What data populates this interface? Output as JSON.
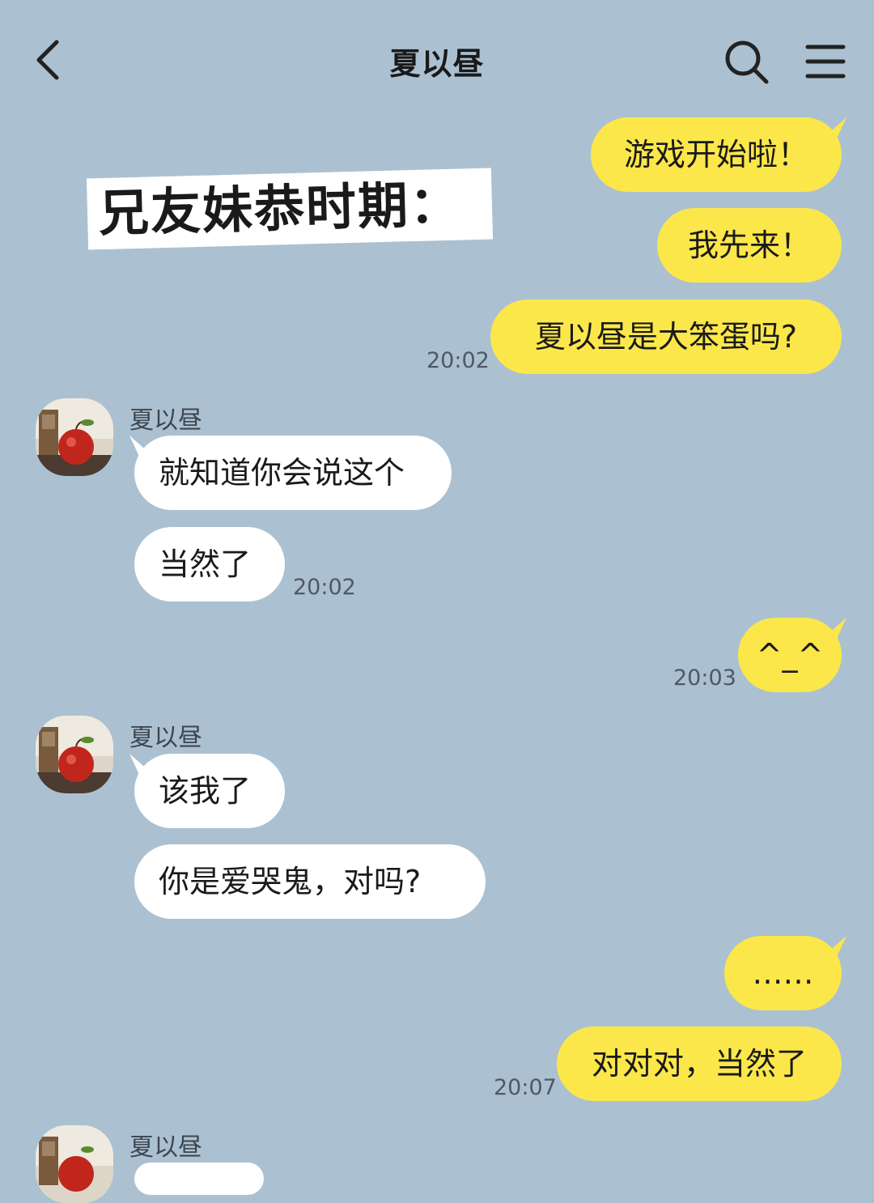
{
  "header": {
    "title": "夏以昼",
    "back_icon": "chevron-left-icon",
    "search_icon": "search-icon",
    "menu_icon": "hamburger-menu-icon"
  },
  "overlay_caption": "兄友妹恭时期：",
  "colors": {
    "background": "#abc1d1",
    "my_bubble": "#fbe74a",
    "their_bubble": "#ffffff",
    "caption_bg": "#ffffff"
  },
  "messages": [
    {
      "from": "me",
      "text": "游戏开始啦！"
    },
    {
      "from": "me",
      "text": "我先来！"
    },
    {
      "from": "me",
      "text": "夏以昼是大笨蛋吗?",
      "time": "20:02"
    },
    {
      "from": "them",
      "sender": "夏以昼",
      "text": "就知道你会说这个"
    },
    {
      "from": "them",
      "text": "当然了",
      "time": "20:02"
    },
    {
      "from": "me",
      "text": "^_^",
      "time": "20:03"
    },
    {
      "from": "them",
      "sender": "夏以昼",
      "text": "该我了"
    },
    {
      "from": "them",
      "text": "你是爱哭鬼，对吗?"
    },
    {
      "from": "me",
      "text": "……"
    },
    {
      "from": "me",
      "text": "对对对，当然了",
      "time": "20:07"
    },
    {
      "from": "them",
      "sender": "夏以昼",
      "text": ""
    }
  ]
}
